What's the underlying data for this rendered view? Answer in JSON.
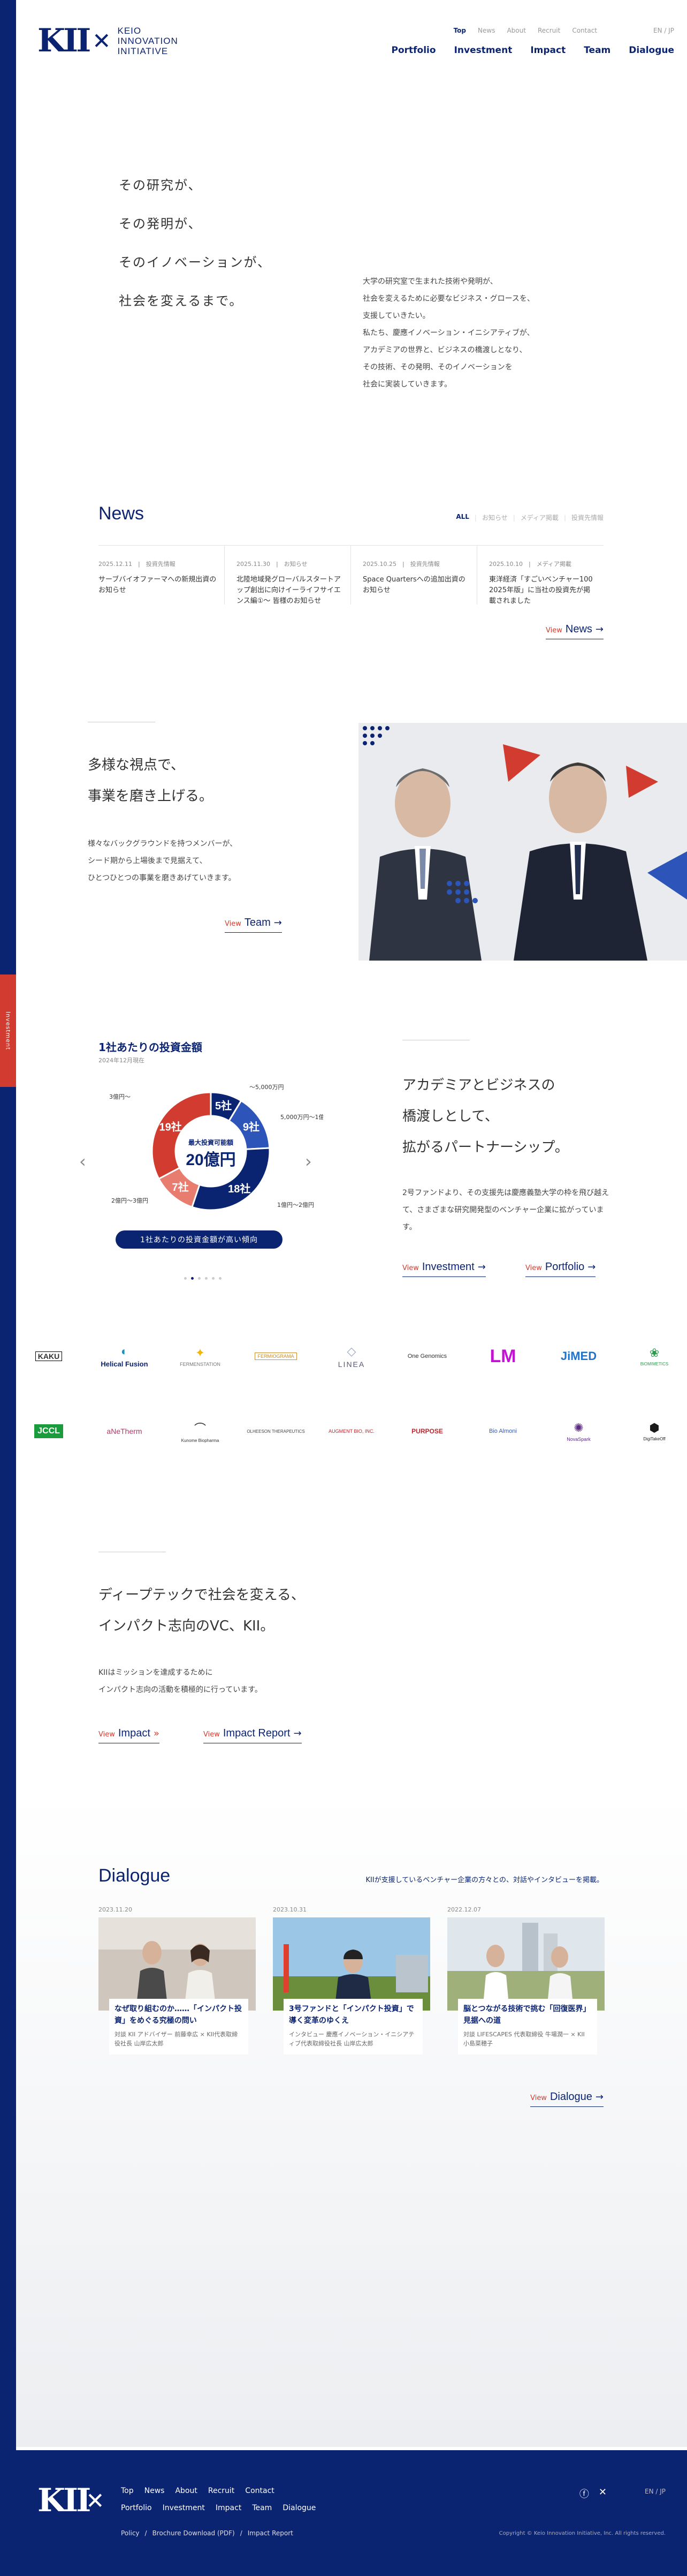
{
  "header": {
    "logo_text": [
      "KEIO",
      "INNOVATION",
      "INITIATIVE"
    ],
    "util_nav": [
      "Top",
      "News",
      "About",
      "Recruit",
      "Contact"
    ],
    "lang": "EN / JP",
    "main_nav": [
      "Portfolio",
      "Investment",
      "Impact",
      "Team",
      "Dialogue"
    ]
  },
  "hero": {
    "lines": [
      "その研究が、",
      "その発明が、",
      "そのイノベーションが、",
      "社会を変えるまで。"
    ],
    "desc": [
      "大学の研究室で生まれた技術や発明が、",
      "社会を変えるために必要なビジネス・グロースを、",
      "支援していきたい。",
      "私たち、慶應イノベーション・イニシアティブが、",
      "アカデミアの世界と、ビジネスの橋渡しとなり、",
      "その技術、その発明、そのイノベーションを",
      "社会に実装していきます。"
    ]
  },
  "news": {
    "title": "News",
    "filters": [
      "ALL",
      "お知らせ",
      "メディア掲載",
      "投資先情報"
    ],
    "items": [
      {
        "date": "2025.12.11",
        "cat": "投資先情報",
        "title": "サーブバイオファーマへの新規出資のお知らせ"
      },
      {
        "date": "2025.11.30",
        "cat": "お知らせ",
        "title": "北陸地域発グローバルスタートアップ創出に向けイーライフサイエンス編①～ 皆様のお知らせ"
      },
      {
        "date": "2025.10.25",
        "cat": "投資先情報",
        "title": "Space Quartersへの追加出資のお知らせ"
      },
      {
        "date": "2025.10.10",
        "cat": "メディア掲載",
        "title": "東洋経済「すごいベンチャー100 2025年版」に当社の投資先が掲載されました"
      }
    ],
    "view_label": "View",
    "more_label": "News"
  },
  "team": {
    "lines": [
      "多様な視点で、",
      "事業を磨き上げる。"
    ],
    "desc": [
      "様々なバックグラウンドを持つメンバーが、",
      "シード期から上場後まで見据えて、",
      "ひとつひとつの事業を磨きあげていきます。"
    ],
    "view_label": "View",
    "link_label": "Team"
  },
  "investment": {
    "title": "1社あたりの投資金額",
    "subtitle": "2024年12月現在",
    "center_label": "最大投資可能額",
    "center_value": "20億円",
    "badge": "1社あたりの投資金額が高い傾向",
    "side_tab": "Investment",
    "chart_labels": [
      "〜5,000万円",
      "5,000万円〜1億円",
      "1億円〜2億円",
      "2億円〜3億円",
      "3億円〜"
    ]
  },
  "chart_data": {
    "type": "pie",
    "title": "1社あたりの投資金額",
    "categories": [
      "〜5,000万円",
      "5,000万円〜1億円",
      "1億円〜2億円",
      "2億円〜3億円",
      "3億円〜"
    ],
    "values": [
      5,
      9,
      18,
      7,
      19
    ],
    "colors": [
      "#0b2471",
      "#2d54b8",
      "#0b2471",
      "#e87d6f",
      "#d23b2f"
    ]
  },
  "partnership": {
    "lines": [
      "アカデミアとビジネスの",
      "橋渡しとして、",
      "拡がるパートナーシップ。"
    ],
    "desc": [
      "2号ファンドより、その支援先は慶應義塾大学の枠を飛び越えて、さまざまな研究開発型のベンチャー企業に拡がっています。"
    ],
    "view_label": "View",
    "invest_label": "Investment",
    "portfolio_label": "Portfolio"
  },
  "logos_row1": [
    "KAKU",
    "Helical Fusion",
    "FERMENSTATION",
    "FERMIOGRAMA",
    "LINEA",
    "One Genomics",
    "LM",
    "JiMED",
    "BiOMIMETICS"
  ],
  "logos_row2": [
    "JCCL",
    "aNeTherm",
    "Kunome Biopharma",
    "OLHEESON THERAPEUTICS",
    "AUGMENT BIO, INC.",
    "PURPOSE",
    "Bio Almoni",
    "NovaSpark",
    "DigiTakeOff"
  ],
  "impact": {
    "lines": [
      "ディープテックで社会を変える、",
      "インパクト志向のVC、KII。"
    ],
    "desc": [
      "KIIはミッションを達成するために",
      "インパクト志向の活動を積極的に行っています。"
    ],
    "view_label": "View",
    "impact_label": "Impact",
    "report_label": "Impact Report"
  },
  "dialogue": {
    "title": "Dialogue",
    "lead": "KIIが支援しているベンチャー企業の方々との、対話やインタビューを掲載。",
    "cards": [
      {
        "date": "2023.11.20",
        "title": "なぜ取り組むのか……「インパクト投資」をめぐる究極の問い",
        "sub": "対談 KII アドバイザー 前藤幸広 × KII代表取締役社長 山岸広太郎"
      },
      {
        "date": "2023.10.31",
        "title": "3号ファンドと「インパクト投資」で導く変革のゆくえ",
        "sub": "インタビュー 慶應イノベーション・イニシアティブ代表取締役社長 山岸広太郎"
      },
      {
        "date": "2022.12.07",
        "title": "脳とつながる技術で挑む「回復医界」見据への道",
        "sub": "対談 LIFESCAPES 代表取締役 牛場潤一 × KII 小島菜穂子"
      }
    ],
    "view_label": "View",
    "link_label": "Dialogue"
  },
  "footer": {
    "nav1": [
      "Top",
      "News",
      "About",
      "Recruit",
      "Contact"
    ],
    "nav2": [
      "Portfolio",
      "Investment",
      "Impact",
      "Team",
      "Dialogue"
    ],
    "nav3": [
      "Policy",
      "/",
      "Brochure Download (PDF)",
      "/",
      "Impact Report"
    ],
    "lang": "EN / JP",
    "copyright": "Copyright © Keio Innovation Initiative, Inc. All rights reserved."
  }
}
